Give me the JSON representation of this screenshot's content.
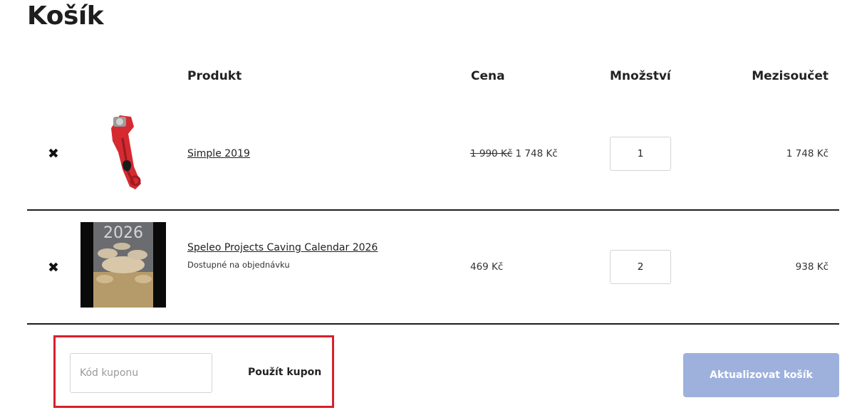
{
  "page": {
    "title": "Košík"
  },
  "table": {
    "headers": {
      "product": "Produkt",
      "price": "Cena",
      "quantity": "Množství",
      "subtotal": "Mezisoučet"
    },
    "rows": [
      {
        "remove_symbol": "✖",
        "image_icon": "descender-device-image",
        "name": "Simple 2019",
        "note": "",
        "price_old": "1 990 Kč",
        "price": "1 748 Kč",
        "quantity": "1",
        "subtotal": "1 748 Kč"
      },
      {
        "remove_symbol": "✖",
        "image_icon": "calendar-cover-image",
        "image_text": "2026",
        "name": "Speleo Projects Caving Calendar 2026",
        "note": "Dostupné na objednávku",
        "price_old": "",
        "price": "469 Kč",
        "quantity": "2",
        "subtotal": "938 Kč"
      }
    ]
  },
  "coupon": {
    "placeholder": "Kód kuponu",
    "button_label": "Použít kupon",
    "highlight_color": "#d8202a"
  },
  "actions": {
    "update_label": "Aktualizovat košík",
    "update_color": "#9eb1dd"
  }
}
